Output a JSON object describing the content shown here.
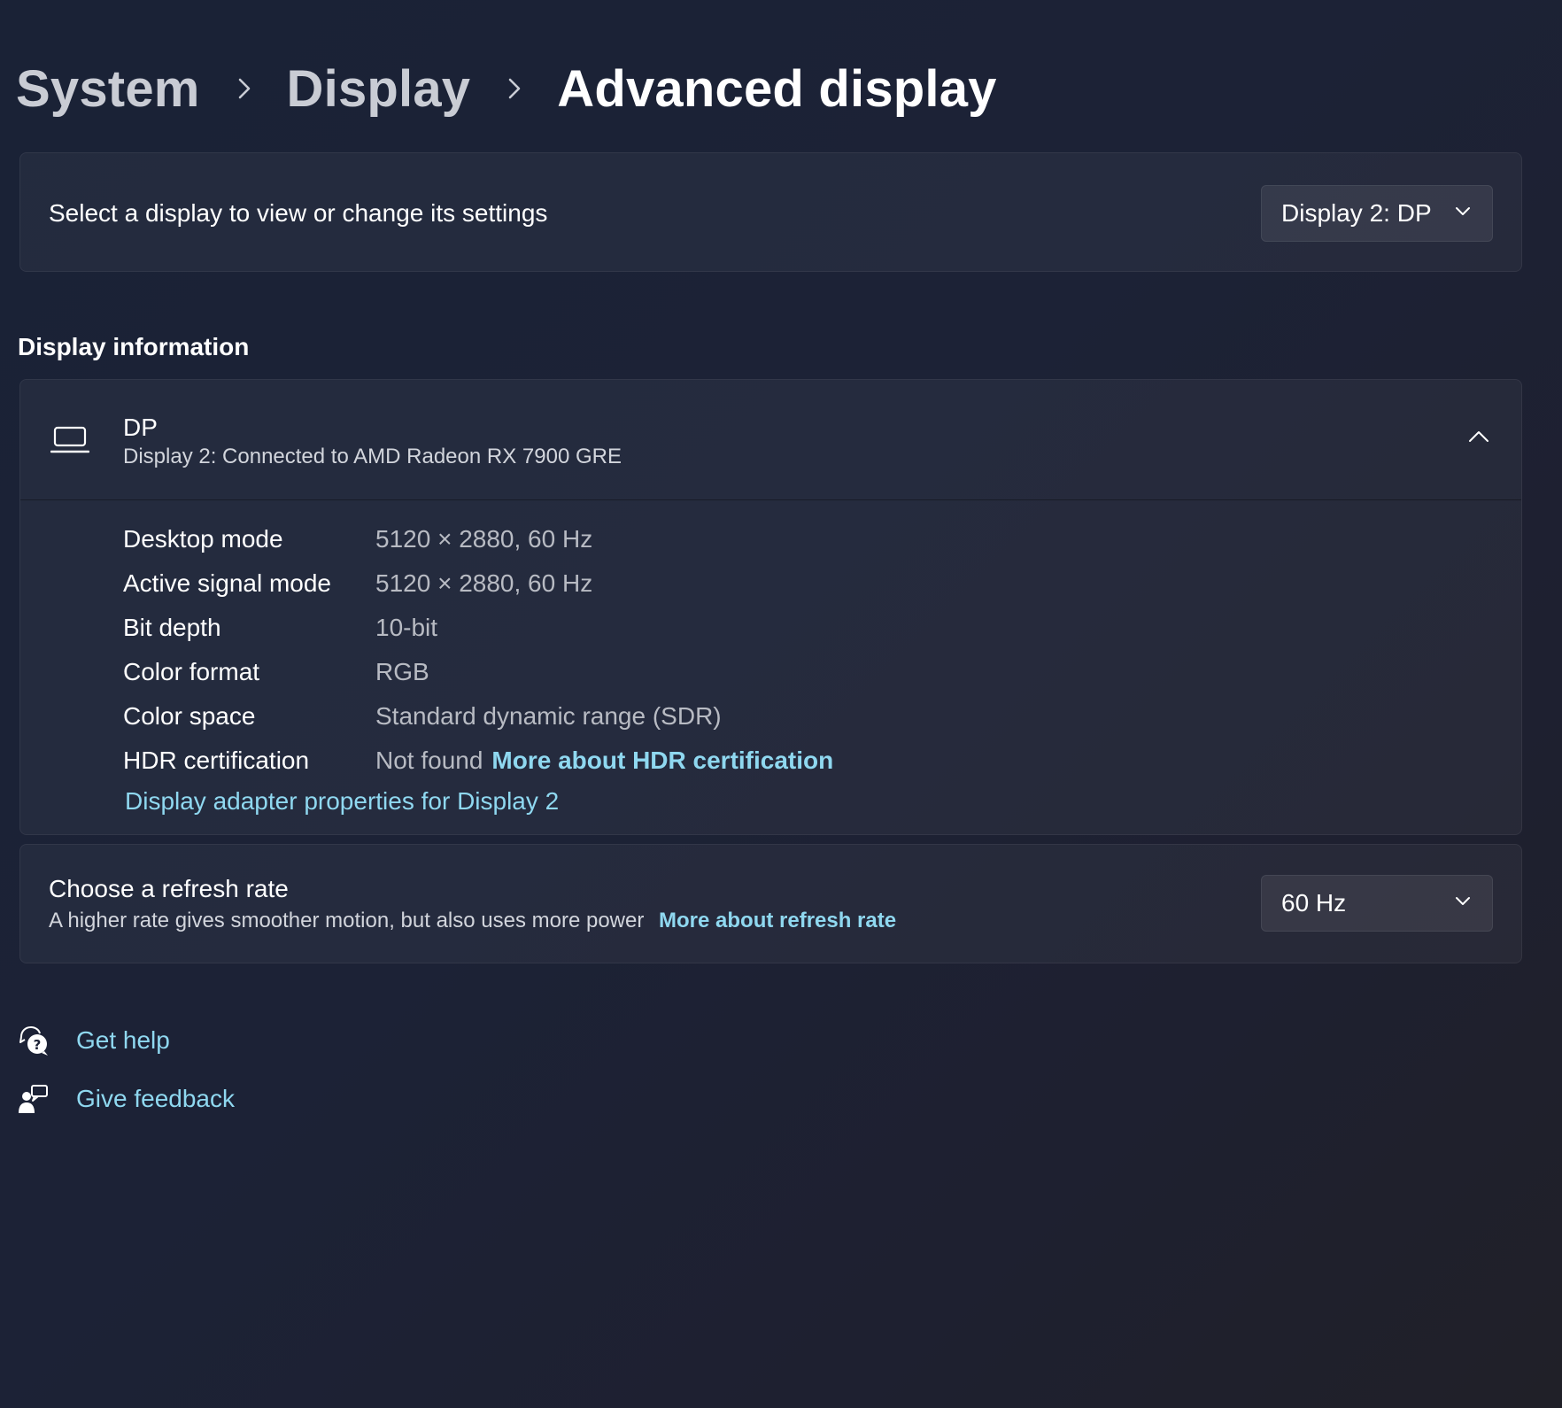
{
  "breadcrumb": {
    "items": [
      {
        "label": "System"
      },
      {
        "label": "Display"
      },
      {
        "label": "Advanced display"
      }
    ]
  },
  "display_select": {
    "label": "Select a display to view or change its settings",
    "selected": "Display 2: DP"
  },
  "display_information": {
    "section_title": "Display information",
    "name": "DP",
    "subtitle": "Display 2: Connected to AMD Radeon RX 7900 GRE",
    "icon": "laptop-icon",
    "rows": [
      {
        "label": "Desktop mode",
        "value": "5120 × 2880, 60 Hz"
      },
      {
        "label": "Active signal mode",
        "value": "5120 × 2880, 60 Hz"
      },
      {
        "label": "Bit depth",
        "value": "10-bit"
      },
      {
        "label": "Color format",
        "value": "RGB"
      },
      {
        "label": "Color space",
        "value": "Standard dynamic range (SDR)"
      },
      {
        "label": "HDR certification",
        "value": "Not found",
        "link": "More about HDR certification"
      }
    ],
    "adapter_link": "Display adapter properties for Display 2"
  },
  "refresh_rate": {
    "title": "Choose a refresh rate",
    "description": "A higher rate gives smoother motion, but also uses more power",
    "link": "More about refresh rate",
    "selected": "60 Hz"
  },
  "footer": {
    "get_help": "Get help",
    "give_feedback": "Give feedback"
  },
  "colors": {
    "accent_link": "#8fd8f0",
    "background": "#1c2236"
  }
}
